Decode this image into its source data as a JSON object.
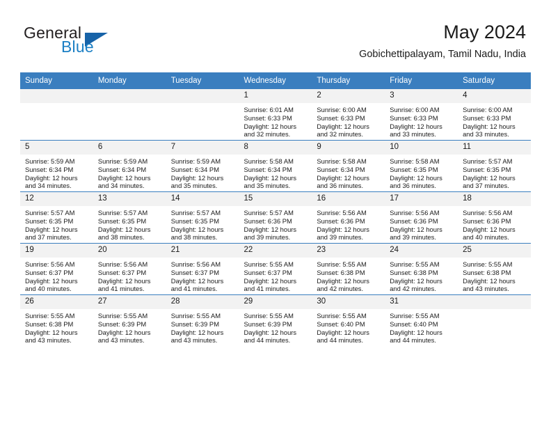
{
  "brand": {
    "word1": "General",
    "word2": "Blue",
    "triangle_color": "#1763a8",
    "blue_color": "#1b7fc4"
  },
  "header": {
    "title": "May 2024",
    "location": "Gobichettipalayam, Tamil Nadu, India"
  },
  "theme": {
    "header_row_bg": "#3a7ebf",
    "daynum_bg": "#f2f2f2",
    "row_divider": "#3a7ebf",
    "text": "#1a1a1a"
  },
  "weekday_headers": [
    "Sunday",
    "Monday",
    "Tuesday",
    "Wednesday",
    "Thursday",
    "Friday",
    "Saturday"
  ],
  "weeks": [
    [
      {
        "day": "",
        "empty": true
      },
      {
        "day": "",
        "empty": true
      },
      {
        "day": "",
        "empty": true
      },
      {
        "day": "1",
        "sunrise": "Sunrise: 6:01 AM",
        "sunset": "Sunset: 6:33 PM",
        "daylight_1": "Daylight: 12 hours",
        "daylight_2": "and 32 minutes."
      },
      {
        "day": "2",
        "sunrise": "Sunrise: 6:00 AM",
        "sunset": "Sunset: 6:33 PM",
        "daylight_1": "Daylight: 12 hours",
        "daylight_2": "and 32 minutes."
      },
      {
        "day": "3",
        "sunrise": "Sunrise: 6:00 AM",
        "sunset": "Sunset: 6:33 PM",
        "daylight_1": "Daylight: 12 hours",
        "daylight_2": "and 33 minutes."
      },
      {
        "day": "4",
        "sunrise": "Sunrise: 6:00 AM",
        "sunset": "Sunset: 6:33 PM",
        "daylight_1": "Daylight: 12 hours",
        "daylight_2": "and 33 minutes."
      }
    ],
    [
      {
        "day": "5",
        "sunrise": "Sunrise: 5:59 AM",
        "sunset": "Sunset: 6:34 PM",
        "daylight_1": "Daylight: 12 hours",
        "daylight_2": "and 34 minutes."
      },
      {
        "day": "6",
        "sunrise": "Sunrise: 5:59 AM",
        "sunset": "Sunset: 6:34 PM",
        "daylight_1": "Daylight: 12 hours",
        "daylight_2": "and 34 minutes."
      },
      {
        "day": "7",
        "sunrise": "Sunrise: 5:59 AM",
        "sunset": "Sunset: 6:34 PM",
        "daylight_1": "Daylight: 12 hours",
        "daylight_2": "and 35 minutes."
      },
      {
        "day": "8",
        "sunrise": "Sunrise: 5:58 AM",
        "sunset": "Sunset: 6:34 PM",
        "daylight_1": "Daylight: 12 hours",
        "daylight_2": "and 35 minutes."
      },
      {
        "day": "9",
        "sunrise": "Sunrise: 5:58 AM",
        "sunset": "Sunset: 6:34 PM",
        "daylight_1": "Daylight: 12 hours",
        "daylight_2": "and 36 minutes."
      },
      {
        "day": "10",
        "sunrise": "Sunrise: 5:58 AM",
        "sunset": "Sunset: 6:35 PM",
        "daylight_1": "Daylight: 12 hours",
        "daylight_2": "and 36 minutes."
      },
      {
        "day": "11",
        "sunrise": "Sunrise: 5:57 AM",
        "sunset": "Sunset: 6:35 PM",
        "daylight_1": "Daylight: 12 hours",
        "daylight_2": "and 37 minutes."
      }
    ],
    [
      {
        "day": "12",
        "sunrise": "Sunrise: 5:57 AM",
        "sunset": "Sunset: 6:35 PM",
        "daylight_1": "Daylight: 12 hours",
        "daylight_2": "and 37 minutes."
      },
      {
        "day": "13",
        "sunrise": "Sunrise: 5:57 AM",
        "sunset": "Sunset: 6:35 PM",
        "daylight_1": "Daylight: 12 hours",
        "daylight_2": "and 38 minutes."
      },
      {
        "day": "14",
        "sunrise": "Sunrise: 5:57 AM",
        "sunset": "Sunset: 6:35 PM",
        "daylight_1": "Daylight: 12 hours",
        "daylight_2": "and 38 minutes."
      },
      {
        "day": "15",
        "sunrise": "Sunrise: 5:57 AM",
        "sunset": "Sunset: 6:36 PM",
        "daylight_1": "Daylight: 12 hours",
        "daylight_2": "and 39 minutes."
      },
      {
        "day": "16",
        "sunrise": "Sunrise: 5:56 AM",
        "sunset": "Sunset: 6:36 PM",
        "daylight_1": "Daylight: 12 hours",
        "daylight_2": "and 39 minutes."
      },
      {
        "day": "17",
        "sunrise": "Sunrise: 5:56 AM",
        "sunset": "Sunset: 6:36 PM",
        "daylight_1": "Daylight: 12 hours",
        "daylight_2": "and 39 minutes."
      },
      {
        "day": "18",
        "sunrise": "Sunrise: 5:56 AM",
        "sunset": "Sunset: 6:36 PM",
        "daylight_1": "Daylight: 12 hours",
        "daylight_2": "and 40 minutes."
      }
    ],
    [
      {
        "day": "19",
        "sunrise": "Sunrise: 5:56 AM",
        "sunset": "Sunset: 6:37 PM",
        "daylight_1": "Daylight: 12 hours",
        "daylight_2": "and 40 minutes."
      },
      {
        "day": "20",
        "sunrise": "Sunrise: 5:56 AM",
        "sunset": "Sunset: 6:37 PM",
        "daylight_1": "Daylight: 12 hours",
        "daylight_2": "and 41 minutes."
      },
      {
        "day": "21",
        "sunrise": "Sunrise: 5:56 AM",
        "sunset": "Sunset: 6:37 PM",
        "daylight_1": "Daylight: 12 hours",
        "daylight_2": "and 41 minutes."
      },
      {
        "day": "22",
        "sunrise": "Sunrise: 5:55 AM",
        "sunset": "Sunset: 6:37 PM",
        "daylight_1": "Daylight: 12 hours",
        "daylight_2": "and 41 minutes."
      },
      {
        "day": "23",
        "sunrise": "Sunrise: 5:55 AM",
        "sunset": "Sunset: 6:38 PM",
        "daylight_1": "Daylight: 12 hours",
        "daylight_2": "and 42 minutes."
      },
      {
        "day": "24",
        "sunrise": "Sunrise: 5:55 AM",
        "sunset": "Sunset: 6:38 PM",
        "daylight_1": "Daylight: 12 hours",
        "daylight_2": "and 42 minutes."
      },
      {
        "day": "25",
        "sunrise": "Sunrise: 5:55 AM",
        "sunset": "Sunset: 6:38 PM",
        "daylight_1": "Daylight: 12 hours",
        "daylight_2": "and 43 minutes."
      }
    ],
    [
      {
        "day": "26",
        "sunrise": "Sunrise: 5:55 AM",
        "sunset": "Sunset: 6:38 PM",
        "daylight_1": "Daylight: 12 hours",
        "daylight_2": "and 43 minutes."
      },
      {
        "day": "27",
        "sunrise": "Sunrise: 5:55 AM",
        "sunset": "Sunset: 6:39 PM",
        "daylight_1": "Daylight: 12 hours",
        "daylight_2": "and 43 minutes."
      },
      {
        "day": "28",
        "sunrise": "Sunrise: 5:55 AM",
        "sunset": "Sunset: 6:39 PM",
        "daylight_1": "Daylight: 12 hours",
        "daylight_2": "and 43 minutes."
      },
      {
        "day": "29",
        "sunrise": "Sunrise: 5:55 AM",
        "sunset": "Sunset: 6:39 PM",
        "daylight_1": "Daylight: 12 hours",
        "daylight_2": "and 44 minutes."
      },
      {
        "day": "30",
        "sunrise": "Sunrise: 5:55 AM",
        "sunset": "Sunset: 6:40 PM",
        "daylight_1": "Daylight: 12 hours",
        "daylight_2": "and 44 minutes."
      },
      {
        "day": "31",
        "sunrise": "Sunrise: 5:55 AM",
        "sunset": "Sunset: 6:40 PM",
        "daylight_1": "Daylight: 12 hours",
        "daylight_2": "and 44 minutes."
      },
      {
        "day": "",
        "empty": true
      }
    ]
  ]
}
